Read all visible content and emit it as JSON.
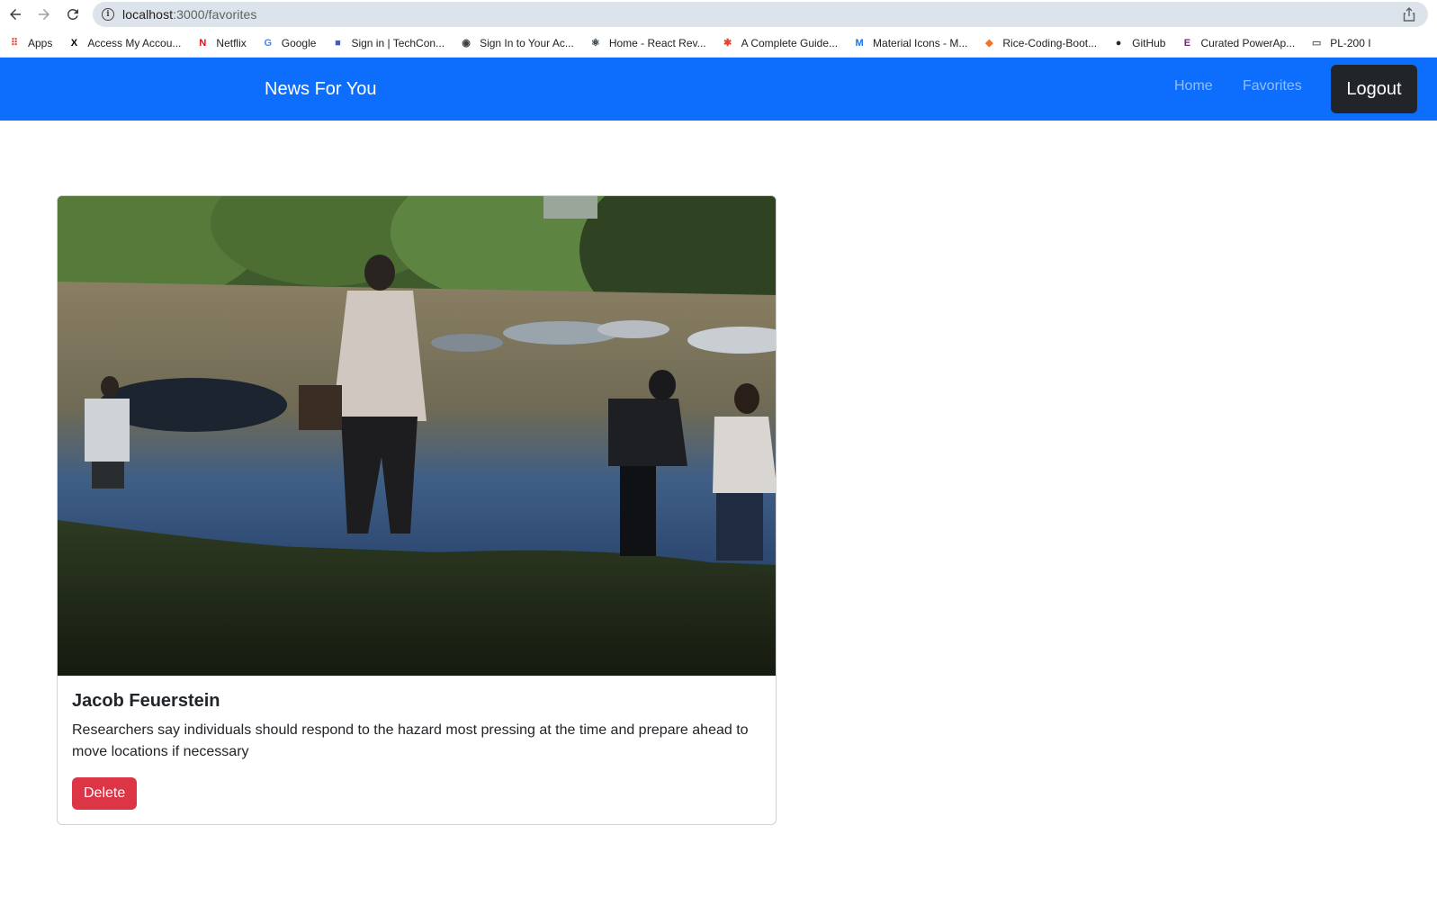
{
  "browser": {
    "url_host": "localhost",
    "url_path": ":3000/favorites",
    "bookmarks": [
      {
        "label": "Apps",
        "icon": "apps-grid-icon",
        "color": "#ea4335"
      },
      {
        "label": "Access My Accou...",
        "icon": "x-icon",
        "color": "#000000"
      },
      {
        "label": "Netflix",
        "icon": "netflix-icon",
        "color": "#e50914"
      },
      {
        "label": "Google",
        "icon": "google-icon",
        "color": "#4285f4"
      },
      {
        "label": "Sign in | TechCon...",
        "icon": "techcon-icon",
        "color": "#3b5bdb"
      },
      {
        "label": "Sign In to Your Ac...",
        "icon": "globe-icon",
        "color": "#3c4043"
      },
      {
        "label": "Home - React Rev...",
        "icon": "react-icon",
        "color": "#1c2b36"
      },
      {
        "label": "A Complete Guide...",
        "icon": "asterisk-icon",
        "color": "#e8432e"
      },
      {
        "label": "Material Icons - M...",
        "icon": "material-icon",
        "color": "#1a73e8"
      },
      {
        "label": "Rice-Coding-Boot...",
        "icon": "gitlab-icon",
        "color": "#fc6d26"
      },
      {
        "label": "GitHub",
        "icon": "github-icon",
        "color": "#24292f"
      },
      {
        "label": "Curated PowerAp...",
        "icon": "powerapps-icon",
        "color": "#742774"
      },
      {
        "label": "PL-200 I",
        "icon": "folder-icon",
        "color": "#5f6368"
      }
    ]
  },
  "navbar": {
    "brand": "News For You",
    "home": "Home",
    "favorites": "Favorites",
    "logout": "Logout",
    "color": "#0d6efd"
  },
  "card": {
    "title": "Jacob Feuerstein",
    "description": "Researchers say individuals should respond to the hazard most pressing at the time and prepare ahead to move locations if necessary",
    "delete_label": "Delete",
    "delete_color": "#dc3545"
  }
}
